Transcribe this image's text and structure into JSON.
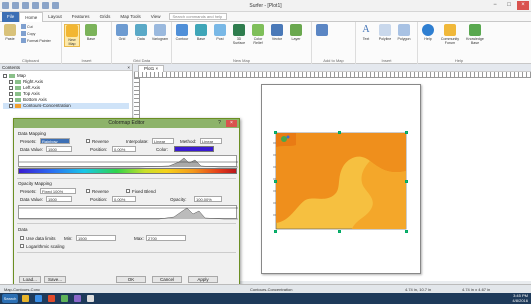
{
  "window": {
    "title": "Surfer - [Plot1]",
    "minimize_glyph": "−",
    "maximize_glyph": "□",
    "close_glyph": "×"
  },
  "ribbon_tabs": [
    {
      "label": "File"
    },
    {
      "label": "Home"
    },
    {
      "label": "Layout"
    },
    {
      "label": "Features"
    },
    {
      "label": "Grids"
    },
    {
      "label": "Map Tools"
    },
    {
      "label": "View"
    }
  ],
  "search": {
    "placeholder": "Search commands and help"
  },
  "ribbon": {
    "clipboard": {
      "label": "Clipboard",
      "paste": "Paste",
      "cut": "Cut",
      "copy": "Copy",
      "format_painter": "Format Painter"
    },
    "insert": {
      "label": "Insert",
      "new": "New Map",
      "base": "Base"
    },
    "grid_data": {
      "label": "Grid Data",
      "items": [
        "Grid",
        "Data",
        "Variogram"
      ]
    },
    "new_map": {
      "label": "New Map",
      "items": [
        "Contour",
        "Base",
        "Post",
        "3D Surface",
        "Color Relief",
        "Vector",
        "Layer"
      ]
    },
    "add_to_map": {
      "label": "Add to Map"
    },
    "insert_text": {
      "label": "Insert",
      "items": [
        "Text",
        "Polyline",
        "Polygon"
      ]
    },
    "help": {
      "label": "Help",
      "items": [
        "Help",
        "Community Forum",
        "Knowledge Base"
      ]
    }
  },
  "contents": {
    "title": "Contents",
    "close": "×",
    "items": [
      {
        "label": "Map"
      },
      {
        "label": "Right Axis"
      },
      {
        "label": "Left Axis"
      },
      {
        "label": "Top Axis"
      },
      {
        "label": "Bottom Axis"
      },
      {
        "label": "Contours-Concentration"
      }
    ]
  },
  "doc_tab": "Plot1 ×",
  "dialog": {
    "title": "Colormap Editor",
    "help": "?",
    "close": "×",
    "data_mapping_label": "Data Mapping",
    "preset_label": "Presets:",
    "preset_value": "Rainbow",
    "reverse_label": "Reverse",
    "interp_label": "Interpolate:",
    "interp_value": "Linear",
    "method_label": "Method:",
    "method_value": "Linear",
    "data_value_label": "Data Value:",
    "data_value": "1500",
    "position_label": "Position:",
    "position_value": "0.00%",
    "color_label": "Color:",
    "opacity_mapping_label": "Opacity Mapping",
    "opacity_preset_label": "Presets:",
    "opacity_preset_value": "Fixed 100%",
    "opacity_reverse": "Reverse",
    "fixed_blend_label": "Fixed Blend",
    "opacity_data_label": "Data Value:",
    "opacity_data_value": "1500",
    "opacity_position_label": "Position:",
    "opacity_position_value": "0.00%",
    "opacity_label": "Opacity:",
    "opacity_value": "100.00%",
    "data_section_label": "Data",
    "use_data_limits": "Use data limits",
    "min_label": "Min:",
    "min_value": "1500",
    "max_label": "Max:",
    "max_value": "2700",
    "logarithmic": "Logarithmic scaling",
    "load_btn": "Load...",
    "save_btn": "Save...",
    "ok_btn": "OK",
    "cancel_btn": "Cancel",
    "apply_btn": "Apply"
  },
  "status": {
    "left": "Map-Contours-Conc",
    "mid": "Contours-Concentration",
    "coords": "4.74 in, 10.7 in",
    "size": "4.74 in x 4.67 in"
  },
  "taskbar": {
    "start": "Search",
    "time": "3:45 PM",
    "date": "4/8/2016"
  },
  "colors": {
    "accent": "#3c6fb5",
    "dialog_title": "#8db36a",
    "map_fill_light": "#f6c040",
    "map_fill_dark": "#ef8f1c",
    "close_red": "#d9534f"
  }
}
